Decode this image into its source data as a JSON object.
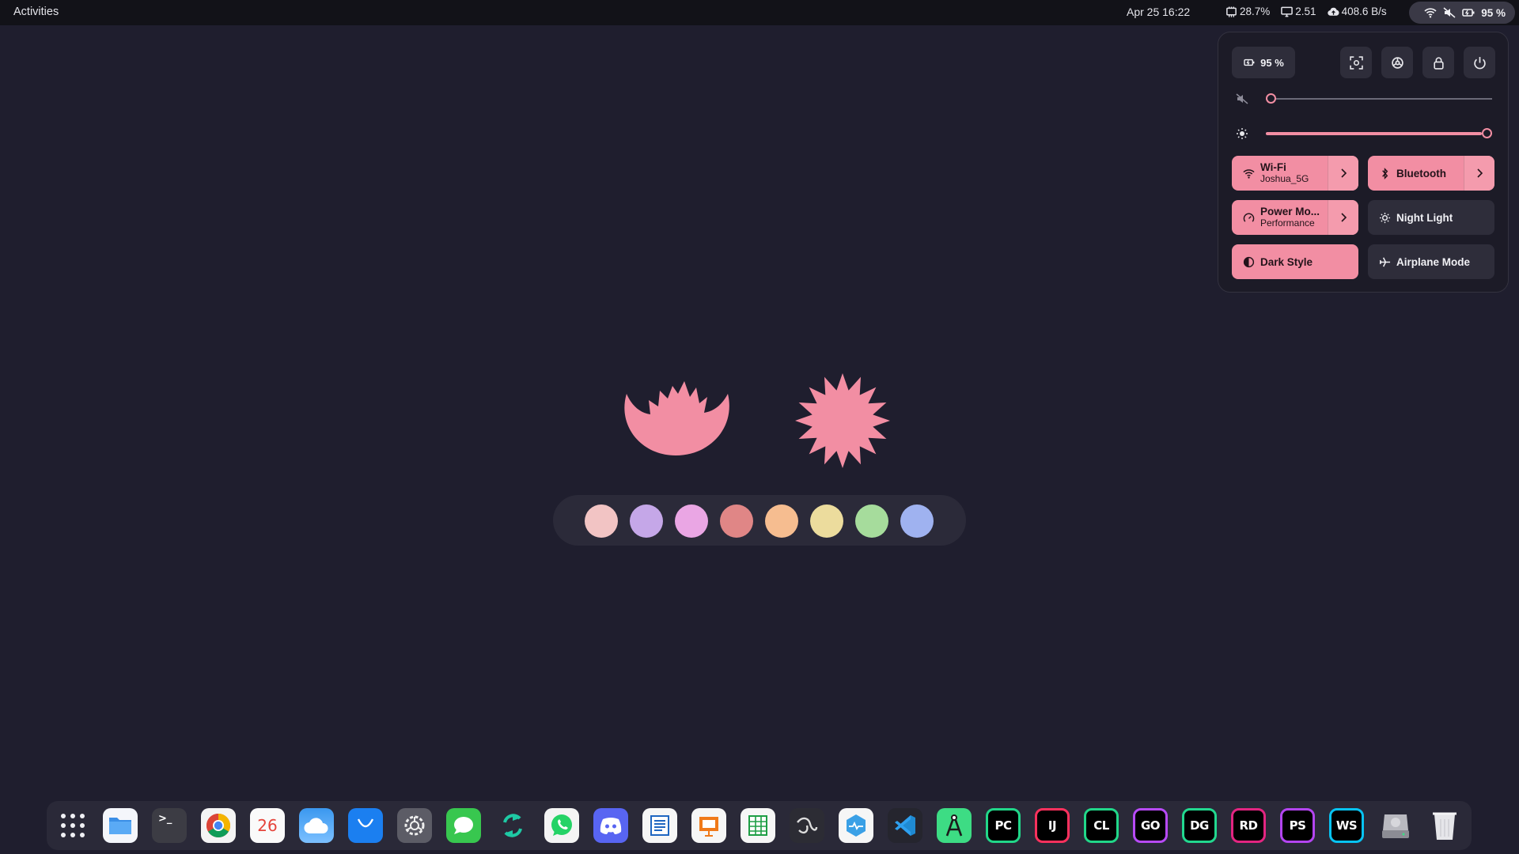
{
  "topbar": {
    "activities": "Activities",
    "datetime": "Apr 25  16:22",
    "cpu": "28.7%",
    "load": "2.51",
    "net": "408.6 B/s",
    "battery": "95 %"
  },
  "quick_settings": {
    "battery": "95 %",
    "volume_level": 0,
    "brightness_level": 1.0,
    "toggles": {
      "wifi": {
        "label": "Wi-Fi",
        "sub": "Joshua_5G"
      },
      "bluetooth": {
        "label": "Bluetooth"
      },
      "power": {
        "label": "Power Mo...",
        "sub": "Performance"
      },
      "night_light": {
        "label": "Night Light"
      },
      "dark_style": {
        "label": "Dark Style"
      },
      "airplane": {
        "label": "Airplane Mode"
      }
    },
    "accent_color": "#f28ea3"
  },
  "palette": [
    "#f2c4c4",
    "#c5a7e8",
    "#eaa6e4",
    "#e08686",
    "#f6bd90",
    "#ecdc9d",
    "#a6dc9c",
    "#9fb2f0"
  ],
  "dock": {
    "calendar_day": "26",
    "jetbrains": {
      "pycharm": "PC",
      "intellij": "IJ",
      "clion": "CL",
      "goland": "GO",
      "datagrip": "DG",
      "rider": "RD",
      "phpstorm": "PS",
      "webstorm": "WS"
    }
  }
}
